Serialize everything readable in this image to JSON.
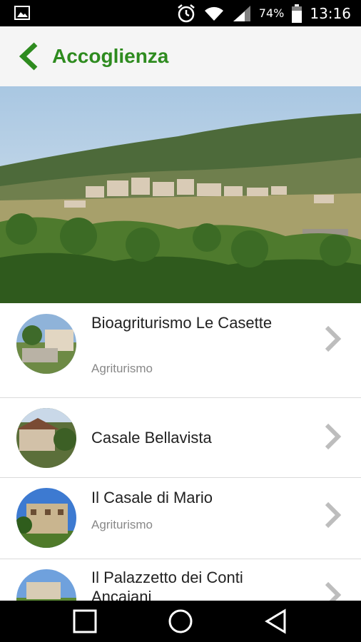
{
  "status_bar": {
    "battery_percent": "74%",
    "time": "13:16",
    "icons": [
      "image-icon",
      "alarm-icon",
      "wifi-icon",
      "signal-icon",
      "battery-icon"
    ]
  },
  "app_bar": {
    "title": "Accoglienza",
    "accent_color": "#2e8b1f"
  },
  "list": {
    "items": [
      {
        "name": "Bioagriturismo Le Casette",
        "category": "Agriturismo"
      },
      {
        "name": "Casale Bellavista",
        "category": ""
      },
      {
        "name": "Il Casale di Mario",
        "category": "Agriturismo"
      },
      {
        "name": "Il Palazzetto dei Conti Ancaiani",
        "category": ""
      }
    ]
  },
  "nav_bar": {
    "buttons": [
      "recent-apps",
      "home",
      "back"
    ]
  }
}
